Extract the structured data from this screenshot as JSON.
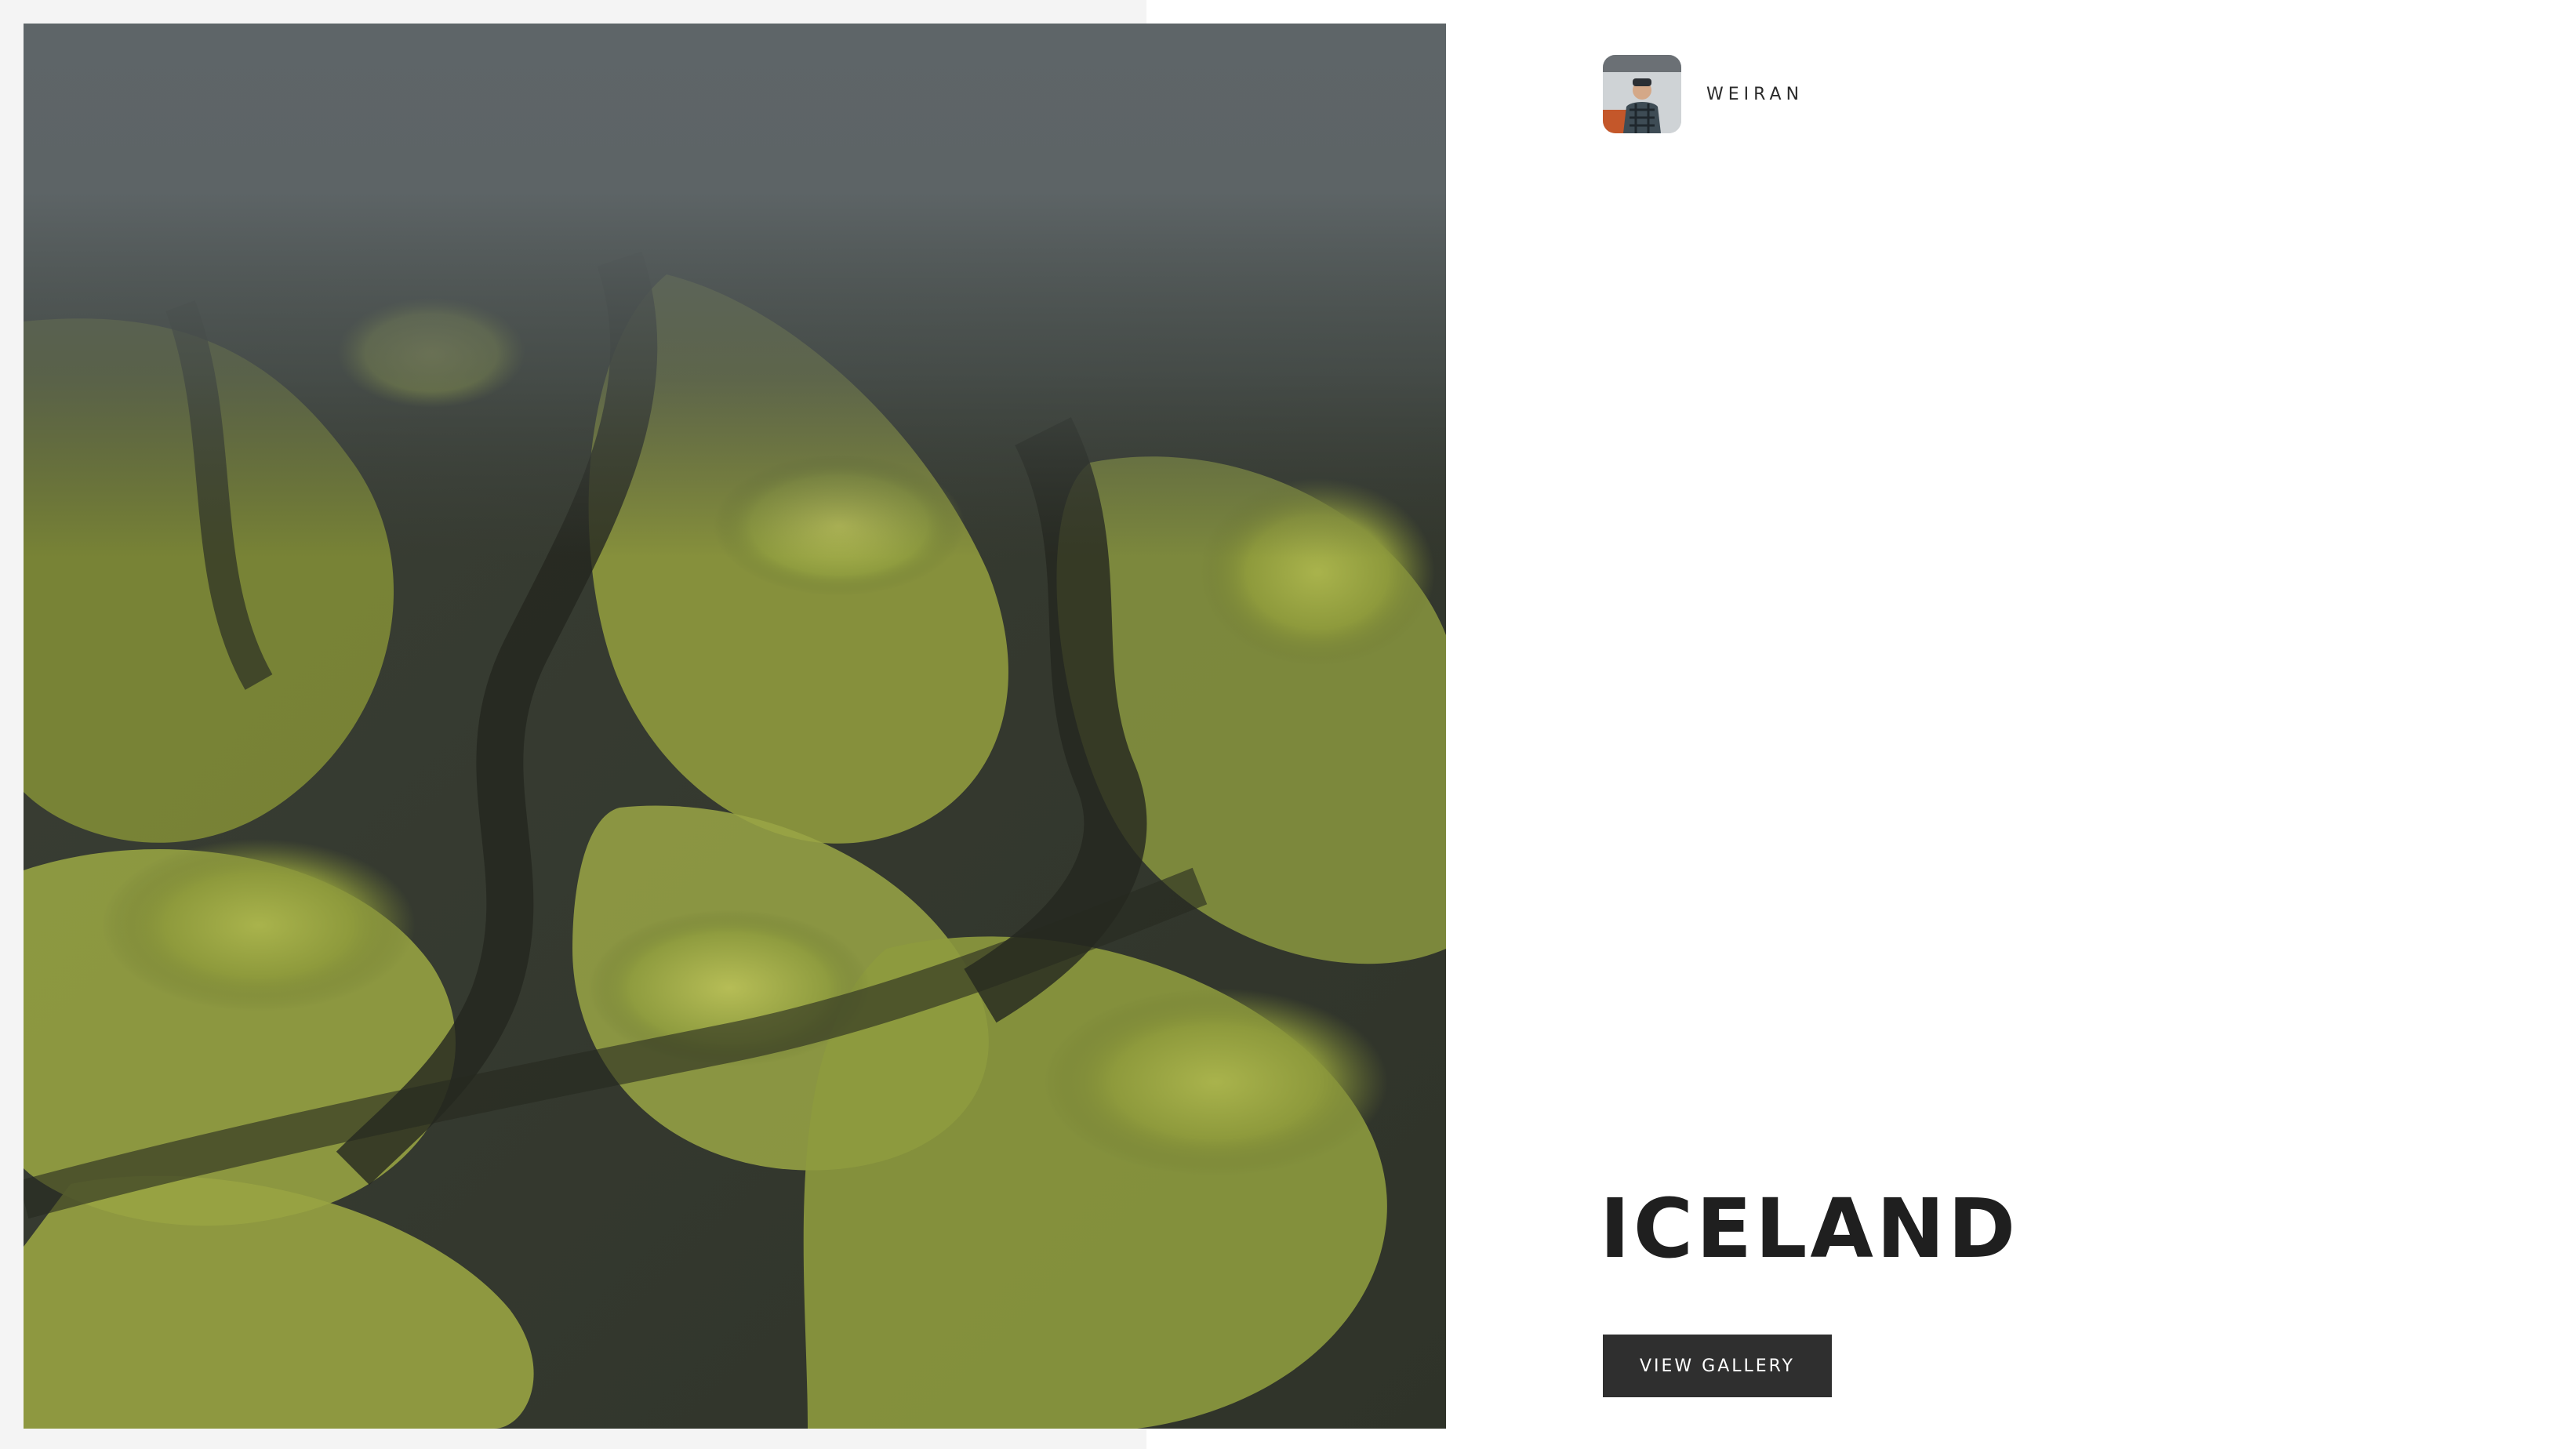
{
  "author": {
    "name": "WEIRAN",
    "avatar_icon": "avatar-photo-icon"
  },
  "hero": {
    "title": "ICELAND",
    "cta_label": "VIEW GALLERY",
    "photo_icon": "mossy-mountain-photo"
  },
  "colors": {
    "page_background": "#ffffff",
    "left_panel_background": "#f4f4f4",
    "title_text": "#1f1f1f",
    "button_background": "#2f2f2f",
    "button_text": "#ffffff"
  }
}
